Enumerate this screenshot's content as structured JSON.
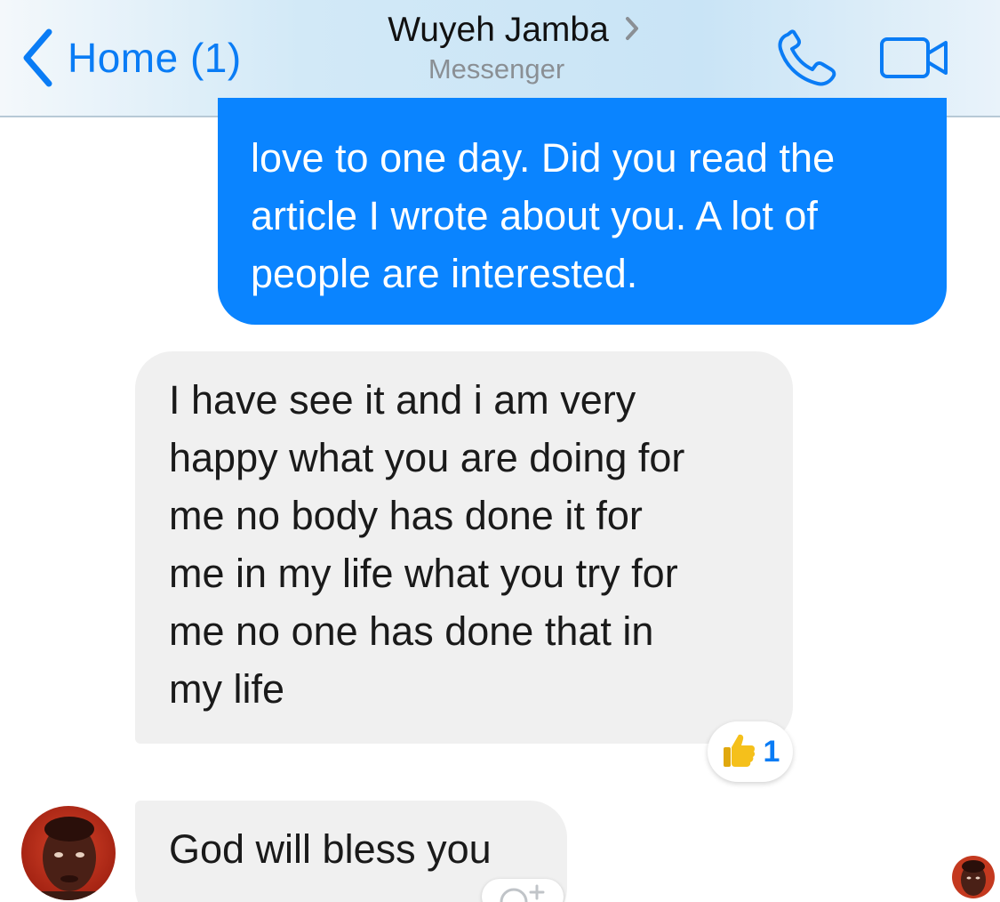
{
  "navbar": {
    "back_label": "Home (1)",
    "title": "Wuyeh Jamba",
    "subtitle": "Messenger",
    "icons": {
      "back": "chevron-left-icon",
      "title_chevron": "chevron-right-icon",
      "call": "phone-icon",
      "video": "video-camera-icon"
    }
  },
  "messages": [
    {
      "direction": "outgoing",
      "lines": [
        "love to one day. Did you read the",
        "article I wrote about you. A lot of",
        "people are interested."
      ]
    },
    {
      "direction": "incoming",
      "lines": [
        "I have see it and i am very",
        "happy what you are doing for",
        "me no body has done it for",
        "me in my life what you try for",
        "me no one has done that in",
        "my life"
      ],
      "reaction": {
        "icon": "thumbs-up-icon",
        "count": "1"
      }
    },
    {
      "direction": "incoming",
      "lines": [
        "God will bless you"
      ]
    }
  ],
  "colors": {
    "accent": "#0a7cf5",
    "outgoing_bubble": "#0a84ff",
    "incoming_bubble": "#f0f0f0",
    "reaction_emoji": "#f5c01b"
  }
}
